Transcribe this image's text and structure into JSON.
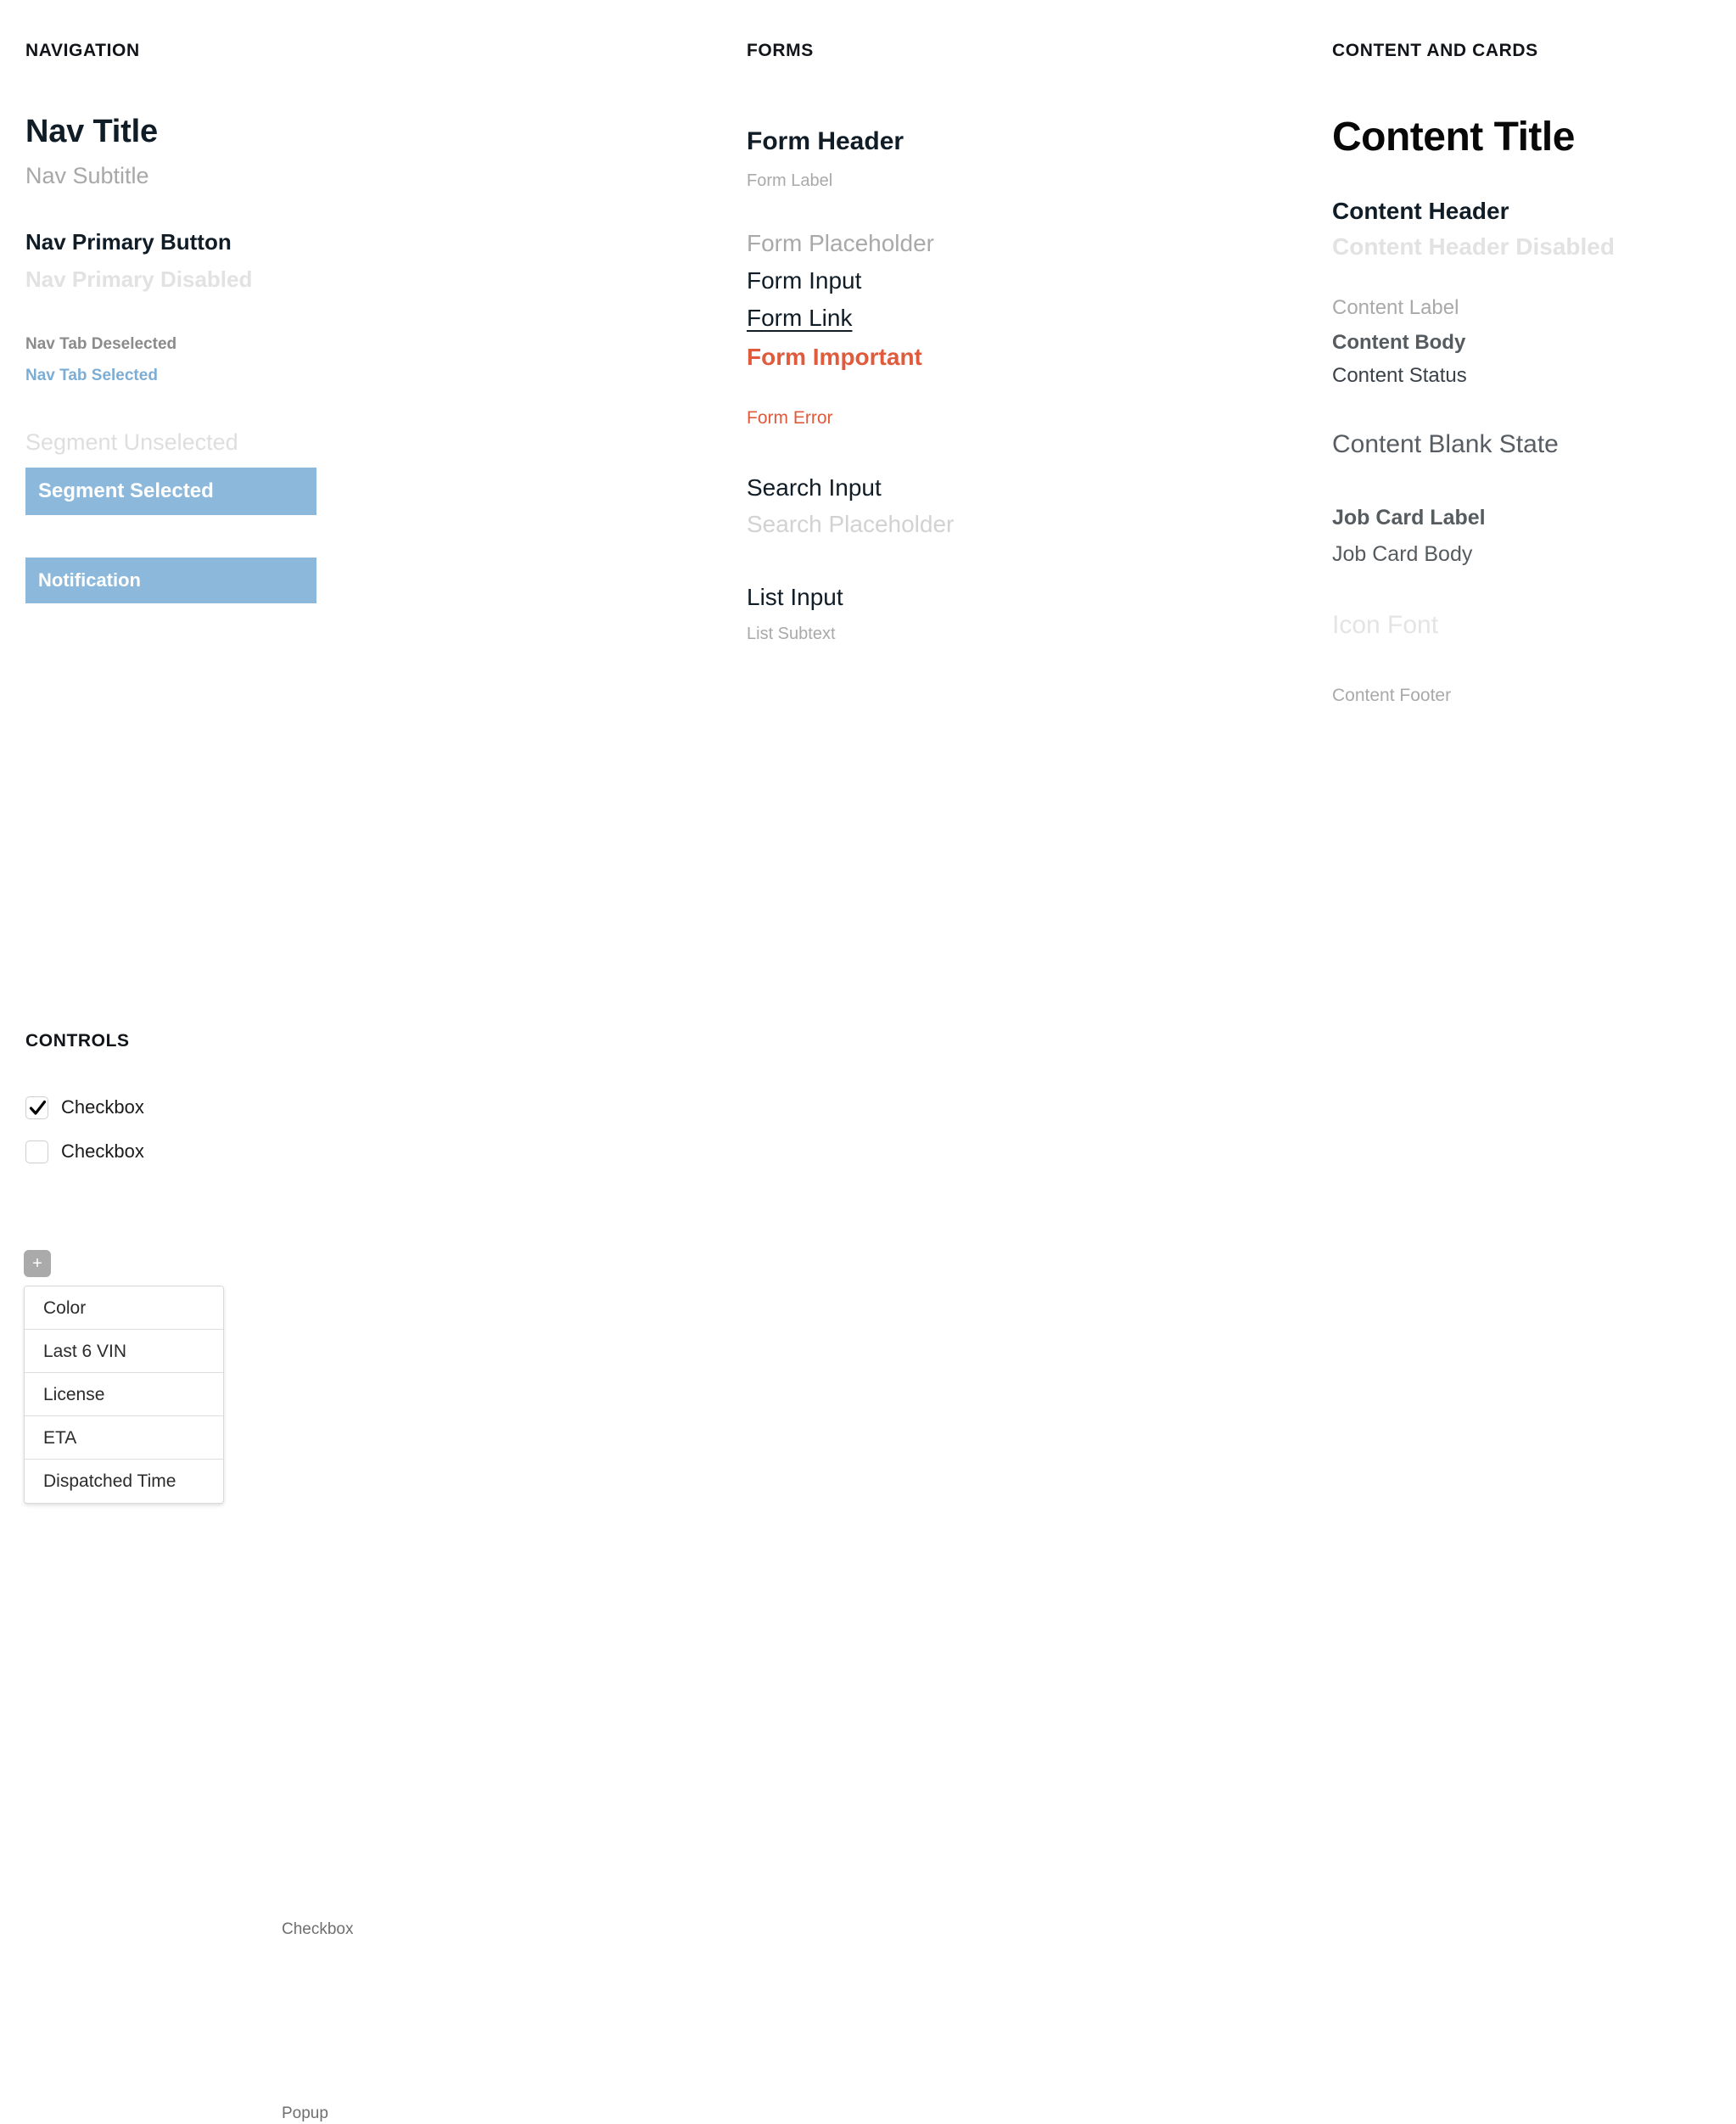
{
  "sections": {
    "navigation": "NAVIGATION",
    "forms": "FORMS",
    "content_and_cards": "CONTENT AND CARDS",
    "controls": "CONTROLS"
  },
  "navigation": {
    "title": "Nav Title",
    "subtitle": "Nav Subtitle",
    "primary_button": "Nav Primary Button",
    "primary_disabled": "Nav Primary Disabled",
    "tab_deselected": "Nav Tab Deselected",
    "tab_selected": "Nav Tab Selected",
    "segment_unselected": "Segment Unselected",
    "segment_selected": "Segment Selected",
    "notification": "Notification"
  },
  "forms": {
    "header": "Form Header",
    "label": "Form Label",
    "placeholder": "Form Placeholder",
    "input_value": "Form Input",
    "link": "Form Link",
    "important": "Form Important",
    "error": "Form Error",
    "search_value": "Search Input",
    "search_placeholder": "Search Placeholder",
    "list_input": "List Input",
    "list_subtext": "List Subtext"
  },
  "content": {
    "title": "Content Title",
    "header": "Content Header",
    "header_disabled": "Content Header Disabled",
    "label": "Content Label",
    "body": "Content Body",
    "status": "Content Status",
    "blank_state": "Content Blank State",
    "job_card_label": "Job Card Label",
    "job_card_body": "Job Card Body",
    "icon_font": "Icon Font",
    "footer": "Content Footer"
  },
  "controls": {
    "checkbox_checked_label": "Checkbox",
    "checkbox_unchecked_label": "Checkbox",
    "checkbox_annotation": "Checkbox",
    "popup_annotation": "Popup",
    "plus_button_label": "+",
    "popup_items": [
      "Color",
      "Last 6 VIN",
      "License",
      "ETA",
      "Dispatched Time"
    ]
  },
  "colors": {
    "accent_blue": "#8cb9db",
    "tab_selected_blue": "#7cadd4",
    "important_orange": "#e05a3c",
    "text_dark": "#101c26",
    "text_muted": "#a9a9a9",
    "text_disabled": "#e2e2e2",
    "plus_button_gray": "#aaaaaa"
  }
}
